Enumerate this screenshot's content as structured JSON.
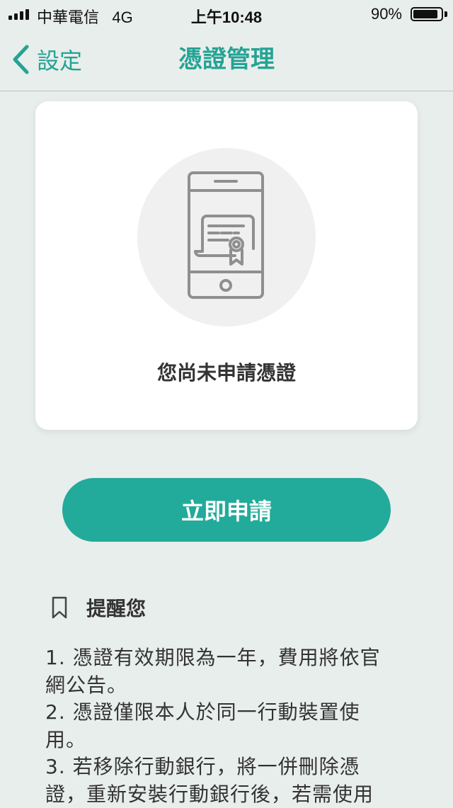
{
  "status_bar": {
    "carrier": "中華電信",
    "network": "4G",
    "time": "上午10:48",
    "battery": "90%",
    "battery_level": 0.9
  },
  "nav": {
    "back_label": "設定",
    "title": "憑證管理"
  },
  "card": {
    "message": "您尚未申請憑證"
  },
  "apply_button": "立即申請",
  "reminder": {
    "title": "提醒您",
    "items": [
      "1. 憑證有效期限為一年，費用將依官網公告。",
      "2. 憑證僅限本人於同一行動裝置使用。",
      "3. 若移除行動銀行，將一併刪除憑證，重新安裝行動銀行後，若需使用"
    ]
  },
  "colors": {
    "accent": "#24a395",
    "button": "#22aa9a",
    "background": "#e8eeeb"
  },
  "icons": [
    "signal-icon",
    "battery-icon",
    "chevron-left-icon",
    "phone-certificate-icon",
    "bookmark-icon"
  ]
}
